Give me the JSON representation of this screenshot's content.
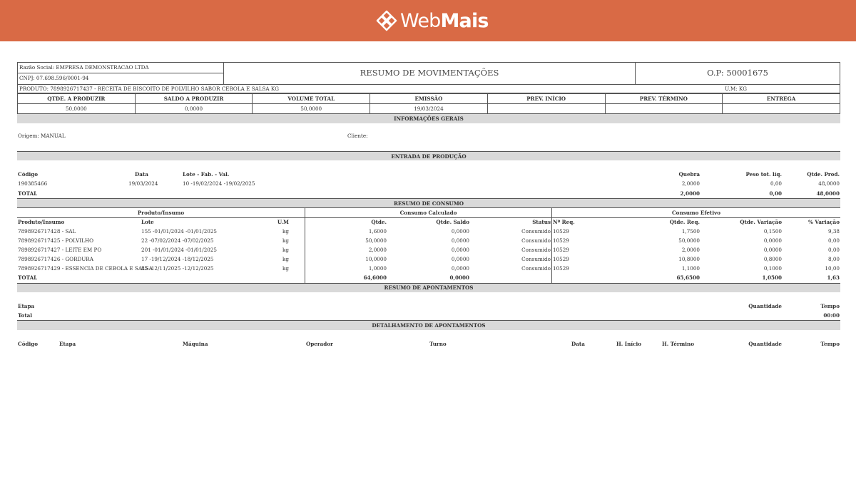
{
  "brand": {
    "logo_web": "Web",
    "logo_mais": "Mais",
    "color": "#d96a45"
  },
  "header": {
    "razao_social": "Razão Social: EMPRESA DEMONSTRACAO LTDA",
    "cnpj": "CNPJ: 07.698.596/0001-94",
    "title": "RESUMO DE MOVIMENTAÇÕES",
    "op": "O.P: 50001675",
    "produto": "PRODUTO: 7898926717437 - RECEITA DE BISCOITO DE POLVILHO SABOR CEBOLA E SALSA KG",
    "um": "U.M: KG"
  },
  "summary": {
    "headers": [
      "QTDE. A PRODUZIR",
      "SALDO A PRODUZIR",
      "VOLUME TOTAL",
      "EMISSÃO",
      "PREV. INÍCIO",
      "PREV. TÉRMINO",
      "ENTREGA"
    ],
    "values": [
      "50,0000",
      "0,0000",
      "50,0000",
      "19/03/2024",
      "",
      "",
      ""
    ]
  },
  "info_gerais": {
    "title": "INFORMAÇÕES GERAIS",
    "origem": "Origem: MANUAL",
    "cliente": "Cliente:"
  },
  "entrada": {
    "title": "ENTRADA DE PRODUÇÃO",
    "headers": {
      "codigo": "Código",
      "data": "Data",
      "lote": "Lote - Fab. - Val.",
      "quebra": "Quebra",
      "peso": "Peso tot. líq.",
      "qtde": "Qtde. Prod."
    },
    "row": {
      "codigo": "190385466",
      "data": "19/03/2024",
      "lote": "10 -19/02/2024 -19/02/2025",
      "quebra": "2,0000",
      "peso": "0,00",
      "qtde": "48,0000"
    },
    "total": {
      "label": "TOTAL",
      "quebra": "2,0000",
      "peso": "0,00",
      "qtde": "48,0000"
    }
  },
  "consumo": {
    "title": "RESUMO DE CONSUMO",
    "groups": {
      "produto": "Produto/Insumo",
      "calculado": "Consumo Calculado",
      "efetivo": "Consumo Efetivo"
    },
    "headers": {
      "produto": "Produto/Insumo",
      "lote": "Lote",
      "um": "U.M",
      "qtde": "Qtde.",
      "saldo": "Qtde. Saldo",
      "status": "Status",
      "nreq": "Nº Req.",
      "qreq": "Qtde. Req.",
      "var": "Qtde. Variação",
      "pvar": "% Variação"
    },
    "rows": [
      {
        "produto": "7898926717428 - SAL",
        "lote": "155 -01/01/2024 -01/01/2025",
        "um": "kg",
        "qtde": "1,6000",
        "saldo": "0,0000",
        "status": "Consumido",
        "nreq": "10529",
        "qreq": "1,7500",
        "var": "0,1500",
        "pvar": "9,38"
      },
      {
        "produto": "7898926717425 - POLVILHO",
        "lote": "22 -07/02/2024 -07/02/2025",
        "um": "kg",
        "qtde": "50,0000",
        "saldo": "0,0000",
        "status": "Consumido",
        "nreq": "10529",
        "qreq": "50,0000",
        "var": "0,0000",
        "pvar": "0,00"
      },
      {
        "produto": "7898926717427 - LEITE EM PO",
        "lote": "201 -01/01/2024 -01/01/2025",
        "um": "kg",
        "qtde": "2,0000",
        "saldo": "0,0000",
        "status": "Consumido",
        "nreq": "10529",
        "qreq": "2,0000",
        "var": "0,0000",
        "pvar": "0,00"
      },
      {
        "produto": "7898926717426 - GORDURA",
        "lote": "17 -19/12/2024 -18/12/2025",
        "um": "kg",
        "qtde": "10,0000",
        "saldo": "0,0000",
        "status": "Consumido",
        "nreq": "10529",
        "qreq": "10,8000",
        "var": "0,8000",
        "pvar": "8,00"
      },
      {
        "produto": "7898926717429 - ESSENCIA DE CEBOLA E SALSA",
        "lote": "85 -12/11/2025 -12/12/2025",
        "um": "kg",
        "qtde": "1,0000",
        "saldo": "0,0000",
        "status": "Consumido",
        "nreq": "10529",
        "qreq": "1,1000",
        "var": "0,1000",
        "pvar": "10,00"
      }
    ],
    "total": {
      "label": "TOTAL",
      "qtde": "64,6000",
      "saldo": "0,0000",
      "qreq": "65,6500",
      "var": "1,0500",
      "pvar": "1,63"
    }
  },
  "apontamentos": {
    "title": "RESUMO DE APONTAMENTOS",
    "etapa": "Etapa",
    "quantidade": "Quantidade",
    "tempo": "Tempo",
    "total_label": "Total",
    "total_tempo": "00:00"
  },
  "detalhamento": {
    "title": "DETALHAMENTO DE APONTAMENTOS",
    "headers": [
      "Código",
      "Etapa",
      "Máquina",
      "Operador",
      "Turno",
      "Data",
      "H. Início",
      "H. Término",
      "Quantidade",
      "Tempo"
    ]
  }
}
